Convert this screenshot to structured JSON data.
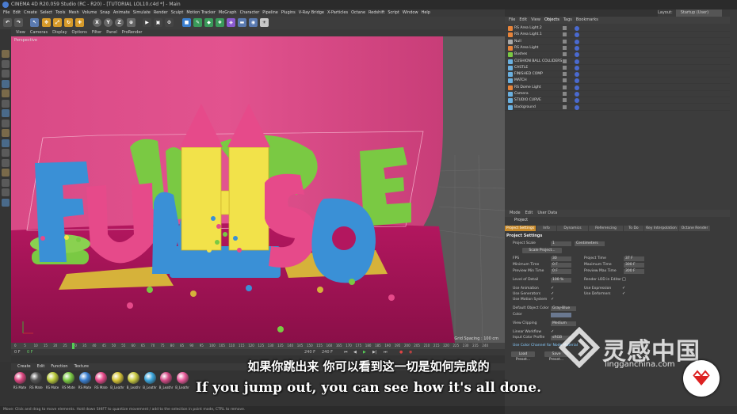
{
  "window": {
    "title": "CINEMA 4D R20.059 Studio (RC - R20) - [TUTORIAL LOL10.c4d *] - Main"
  },
  "menu": [
    "File",
    "Edit",
    "Create",
    "Select",
    "Tools",
    "Mesh",
    "Volume",
    "Snap",
    "Animate",
    "Simulate",
    "Render",
    "Sculpt",
    "Motion Tracker",
    "MoGraph",
    "Character",
    "Pipeline",
    "Plugins",
    "V-Ray Bridge",
    "X-Particles",
    "Octane",
    "Redshift",
    "Script",
    "Window",
    "Help"
  ],
  "layout": {
    "label": "Layout:",
    "value": "Startup (User)"
  },
  "toolbar_axes": [
    "X",
    "Y",
    "Z"
  ],
  "viewport": {
    "menu": [
      "View",
      "Cameras",
      "Display",
      "Options",
      "Filter",
      "Panel",
      "ProRender"
    ],
    "label": "Perspective",
    "grid_spacing": "Grid Spacing : 100 cm"
  },
  "timeline": {
    "ticks": [
      "0",
      "5",
      "10",
      "15",
      "20",
      "25",
      "30",
      "35",
      "40",
      "45",
      "50",
      "55",
      "60",
      "65",
      "70",
      "75",
      "80",
      "85",
      "90",
      "95",
      "100",
      "105",
      "110",
      "115",
      "120",
      "125",
      "130",
      "135",
      "140",
      "145",
      "150",
      "155",
      "160",
      "165",
      "170",
      "175",
      "180",
      "185",
      "190",
      "195",
      "200",
      "205",
      "210",
      "215",
      "220",
      "225",
      "230",
      "235",
      "240"
    ],
    "start": "0 F",
    "current": "0 F",
    "end": "240 F",
    "end2": "240 F"
  },
  "materials": {
    "menu": [
      "Create",
      "Edit",
      "Function",
      "Texture"
    ],
    "items": [
      {
        "name": "RS Mate",
        "color": "#d9457f"
      },
      {
        "name": "RS Mate",
        "color": "#555555"
      },
      {
        "name": "RS Mate",
        "color": "#b8c93a"
      },
      {
        "name": "RS Mate",
        "color": "#7ac943"
      },
      {
        "name": "RS Mate",
        "color": "#3a7fd0"
      },
      {
        "name": "RS Mate",
        "color": "#e64a8a"
      },
      {
        "name": "B_Leathr",
        "color": "#d6c437"
      },
      {
        "name": "B_Leathr",
        "color": "#c8c940"
      },
      {
        "name": "B_Leathr",
        "color": "#3aa3d9"
      },
      {
        "name": "B_Leathr",
        "color": "#d24a85"
      },
      {
        "name": "B_Leathr",
        "color": "#e85a9a"
      }
    ]
  },
  "status": "Move: Click and drag to move elements. Hold down SHIFT to quantize movement / add to the selection in point mode, CTRL to remove.",
  "objects": {
    "menu": [
      "File",
      "Edit",
      "View",
      "Objects",
      "Tags",
      "Bookmarks"
    ],
    "active": "Objects",
    "rows": [
      {
        "name": "RS Area Light.2",
        "color": "#e8843a"
      },
      {
        "name": "RS Area Light.1",
        "color": "#e8843a"
      },
      {
        "name": "Null",
        "color": "#aaaaaa"
      },
      {
        "name": "RS Area Light",
        "color": "#e8843a"
      },
      {
        "name": "Bushes",
        "color": "#7ac943"
      },
      {
        "name": "CUSHION BALL COLLIDERS",
        "color": "#6ab0e0"
      },
      {
        "name": "CASTLE",
        "color": "#6ab0e0"
      },
      {
        "name": "FINISHED COMP",
        "color": "#6ab0e0"
      },
      {
        "name": "MATCH",
        "color": "#6ab0e0"
      },
      {
        "name": "RS Dome Light",
        "color": "#e8843a"
      },
      {
        "name": "Camera",
        "color": "#6ab0e0"
      },
      {
        "name": "STUDIO CURVE",
        "color": "#6ab0e0"
      },
      {
        "name": "Background",
        "color": "#6ab0e0"
      }
    ]
  },
  "attributes": {
    "menu": [
      "Mode",
      "Edit",
      "User Data"
    ],
    "title": "Project",
    "tabs": [
      "Project Settings",
      "Info",
      "Dynamics",
      "Referencing",
      "To Do",
      "Key Interpolation",
      "Octane Render"
    ],
    "section": "Project Settings",
    "project_scale_label": "Project Scale",
    "project_scale_value": "1",
    "project_scale_unit": "Centimeters",
    "scale_project_btn": "Scale Project...",
    "fps_label": "FPS",
    "fps": "30",
    "project_time_label": "Project Time",
    "project_time": "37 F",
    "min_time_label": "Minimum Time",
    "min_time": "0 F",
    "max_time_label": "Maximum Time",
    "max_time": "300 F",
    "preview_min_label": "Preview Min Time",
    "preview_min": "0 F",
    "preview_max_label": "Preview Max Time",
    "preview_max": "300 F",
    "lod_label": "Level of Detail",
    "lod": "100 %",
    "render_lod_label": "Render LOD in Editor",
    "use_animation": "Use Animation",
    "use_expression": "Use Expression",
    "use_generators": "Use Generators",
    "use_deformers": "Use Deformers",
    "use_motion": "Use Motion System",
    "default_color_label": "Default Object Color",
    "default_color": "Gray-Blue",
    "color_label": "Color",
    "view_clipping_label": "View Clipping",
    "view_clipping": "Medium",
    "linear_label": "Linear Workflow",
    "input_profile_label": "Input Color Profile",
    "input_profile": "sRGB",
    "node_label": "Use Color Channel for Node Material",
    "load_preset": "Load Preset...",
    "save_preset": "Save Preset..."
  },
  "subtitles": {
    "cn": "如果你跳出来 你可以看到这一切是如何完成的",
    "en": "If you jump out, you can see how it's all done."
  },
  "watermark": {
    "text": "灵感中国",
    "url": "lingganchina.com"
  }
}
